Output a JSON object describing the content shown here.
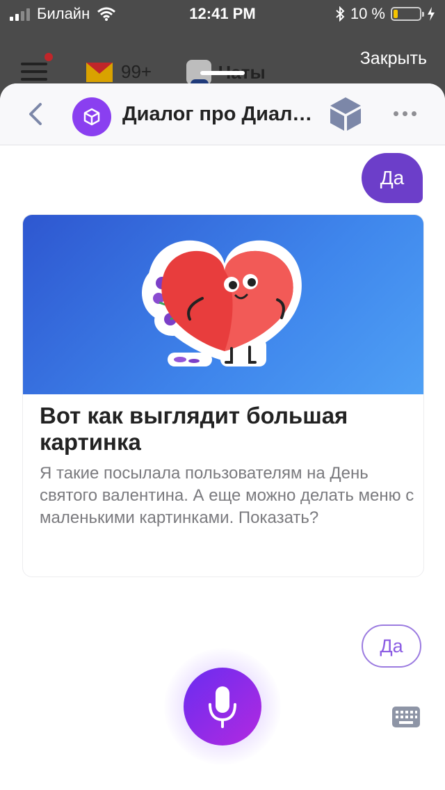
{
  "status_bar": {
    "carrier": "Билайн",
    "time": "12:41 PM",
    "battery": "10 %",
    "battery_level": 0.1
  },
  "background_app": {
    "mail_count": "99+",
    "chats_label": "Чаты",
    "close_label": "Закрыть"
  },
  "chat_header": {
    "title": "Диалог про Диалоги"
  },
  "messages": {
    "user_message": "Да"
  },
  "card": {
    "title": "Вот как выглядит большая картинка",
    "text": "Я такие посылала пользователям на День святого валентина. А еще можно делать меню с маленькими картинками. Показать?"
  },
  "suggest": {
    "label": "Да"
  },
  "colors": {
    "accent": "#6c3ec9",
    "avatar": "#8a3ff0",
    "mic_gradient_start": "#6a2cf0",
    "mic_gradient_end": "#b22ae0",
    "card_image_blue": "#3f86ec"
  }
}
